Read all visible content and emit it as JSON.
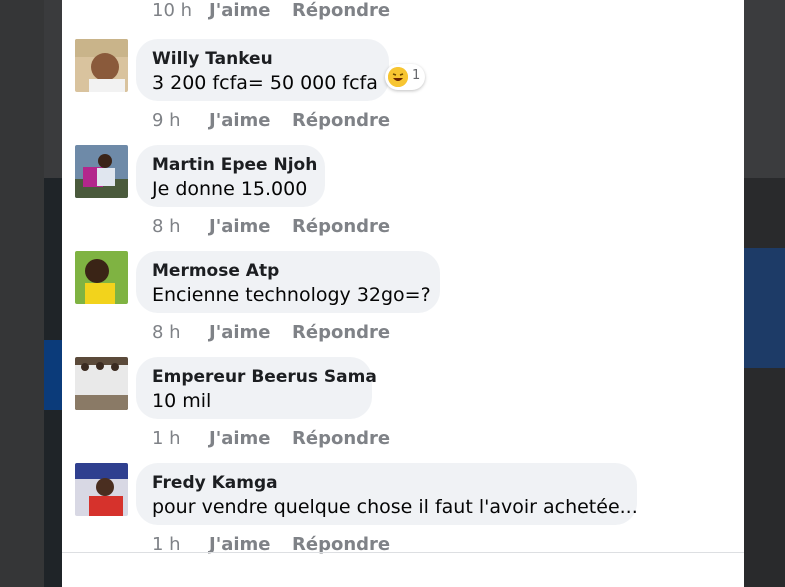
{
  "top_meta": {
    "time": "10 h",
    "like": "J'aime",
    "reply": "Répondre"
  },
  "comments": [
    {
      "author": "Willy Tankeu",
      "text": "3 200 fcfa= 50 000 fcfa",
      "time": "9 h",
      "like": "J'aime",
      "reply": "Répondre",
      "reaction": {
        "icon": "laugh-emoji-icon",
        "count": "1"
      }
    },
    {
      "author": "Martin Epee Njoh",
      "text": "Je donne 15.000",
      "time": "8 h",
      "like": "J'aime",
      "reply": "Répondre"
    },
    {
      "author": "Mermose Atp",
      "text": "Encienne technology 32go=?",
      "time": "8 h",
      "like": "J'aime",
      "reply": "Répondre"
    },
    {
      "author": "Empereur Beerus Sama",
      "text": "10 mil",
      "time": "1 h",
      "like": "J'aime",
      "reply": "Répondre"
    },
    {
      "author": "Fredy Kamga",
      "text": "pour vendre quelque chose il faut l'avoir achetée...",
      "time": "1 h",
      "like": "J'aime",
      "reply": "Répondre"
    }
  ],
  "colors": {
    "bubble": "#f0f2f5",
    "meta": "#7f8287",
    "link": "#385898"
  }
}
